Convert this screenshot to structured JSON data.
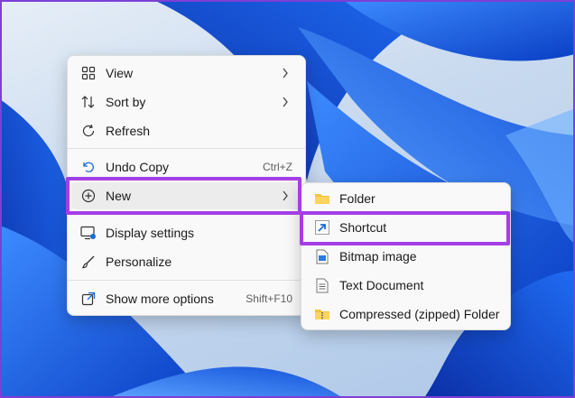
{
  "context_menu": {
    "items": [
      {
        "label": "View",
        "icon": "grid-icon",
        "submenu": true
      },
      {
        "label": "Sort by",
        "icon": "sort-arrows-icon",
        "submenu": true
      },
      {
        "label": "Refresh",
        "icon": "refresh-icon"
      },
      {
        "label": "Undo Copy",
        "icon": "undo-icon",
        "shortcut": "Ctrl+Z"
      },
      {
        "label": "New",
        "icon": "plus-circle-icon",
        "submenu": true,
        "state": "active"
      },
      {
        "label": "Display settings",
        "icon": "display-icon"
      },
      {
        "label": "Personalize",
        "icon": "brush-icon"
      },
      {
        "label": "Show more options",
        "icon": "open-external-icon",
        "shortcut": "Shift+F10"
      }
    ]
  },
  "new_submenu": {
    "items": [
      {
        "label": "Folder",
        "icon": "folder-icon"
      },
      {
        "label": "Shortcut",
        "icon": "shortcut-arrow-icon"
      },
      {
        "label": "Bitmap image",
        "icon": "bitmap-image-icon"
      },
      {
        "label": "Text Document",
        "icon": "text-document-icon"
      },
      {
        "label": "Compressed (zipped) Folder",
        "icon": "zip-folder-icon"
      }
    ]
  },
  "colors": {
    "highlight": "#a43ee6",
    "menu_background": "#f9f9f9",
    "wallpaper_blue": "#1a6cf0"
  }
}
